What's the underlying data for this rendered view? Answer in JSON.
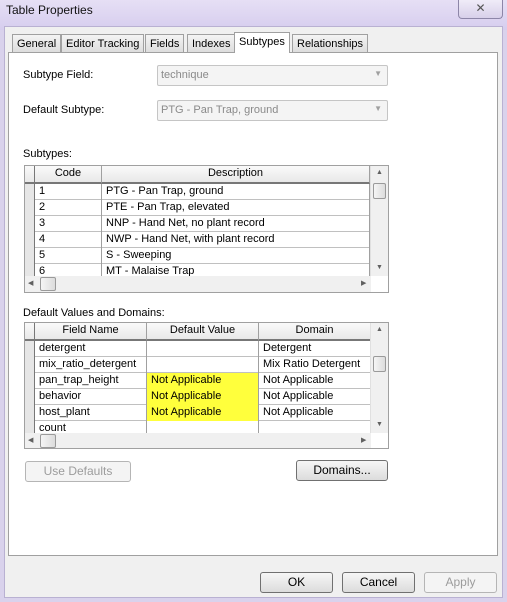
{
  "window": {
    "title": "Table Properties",
    "close_icon": "close-icon"
  },
  "tabs": [
    {
      "label": "General"
    },
    {
      "label": "Editor Tracking"
    },
    {
      "label": "Fields"
    },
    {
      "label": "Indexes"
    },
    {
      "label": "Subtypes",
      "active": true
    },
    {
      "label": "Relationships"
    }
  ],
  "subtype_field": {
    "label": "Subtype Field:",
    "value": "technique"
  },
  "default_subtype": {
    "label": "Default Subtype:",
    "value": "PTG - Pan Trap, ground"
  },
  "subtypes": {
    "label": "Subtypes:",
    "columns": [
      "Code",
      "Description"
    ],
    "rows": [
      [
        "1",
        "PTG - Pan Trap, ground"
      ],
      [
        "2",
        "PTE - Pan Trap, elevated"
      ],
      [
        "3",
        "NNP - Hand Net, no plant record"
      ],
      [
        "4",
        "NWP - Hand Net, with plant record"
      ],
      [
        "5",
        "S - Sweeping"
      ],
      [
        "6",
        "MT - Malaise Trap"
      ]
    ]
  },
  "defaults": {
    "label": "Default Values and Domains:",
    "columns": [
      "Field Name",
      "Default Value",
      "Domain"
    ],
    "rows": [
      [
        "detergent",
        "",
        "Detergent"
      ],
      [
        "mix_ratio_detergent",
        "",
        "Mix Ratio Detergent"
      ],
      [
        "pan_trap_height",
        "Not Applicable",
        "Not Applicable"
      ],
      [
        "behavior",
        "Not Applicable",
        "Not Applicable"
      ],
      [
        "host_plant",
        "Not Applicable",
        "Not Applicable"
      ],
      [
        "count",
        "",
        ""
      ]
    ],
    "highlight_color": "#ffff3c"
  },
  "buttons": {
    "use_defaults": "Use Defaults",
    "domains": "Domains...",
    "ok": "OK",
    "cancel": "Cancel",
    "apply": "Apply"
  }
}
